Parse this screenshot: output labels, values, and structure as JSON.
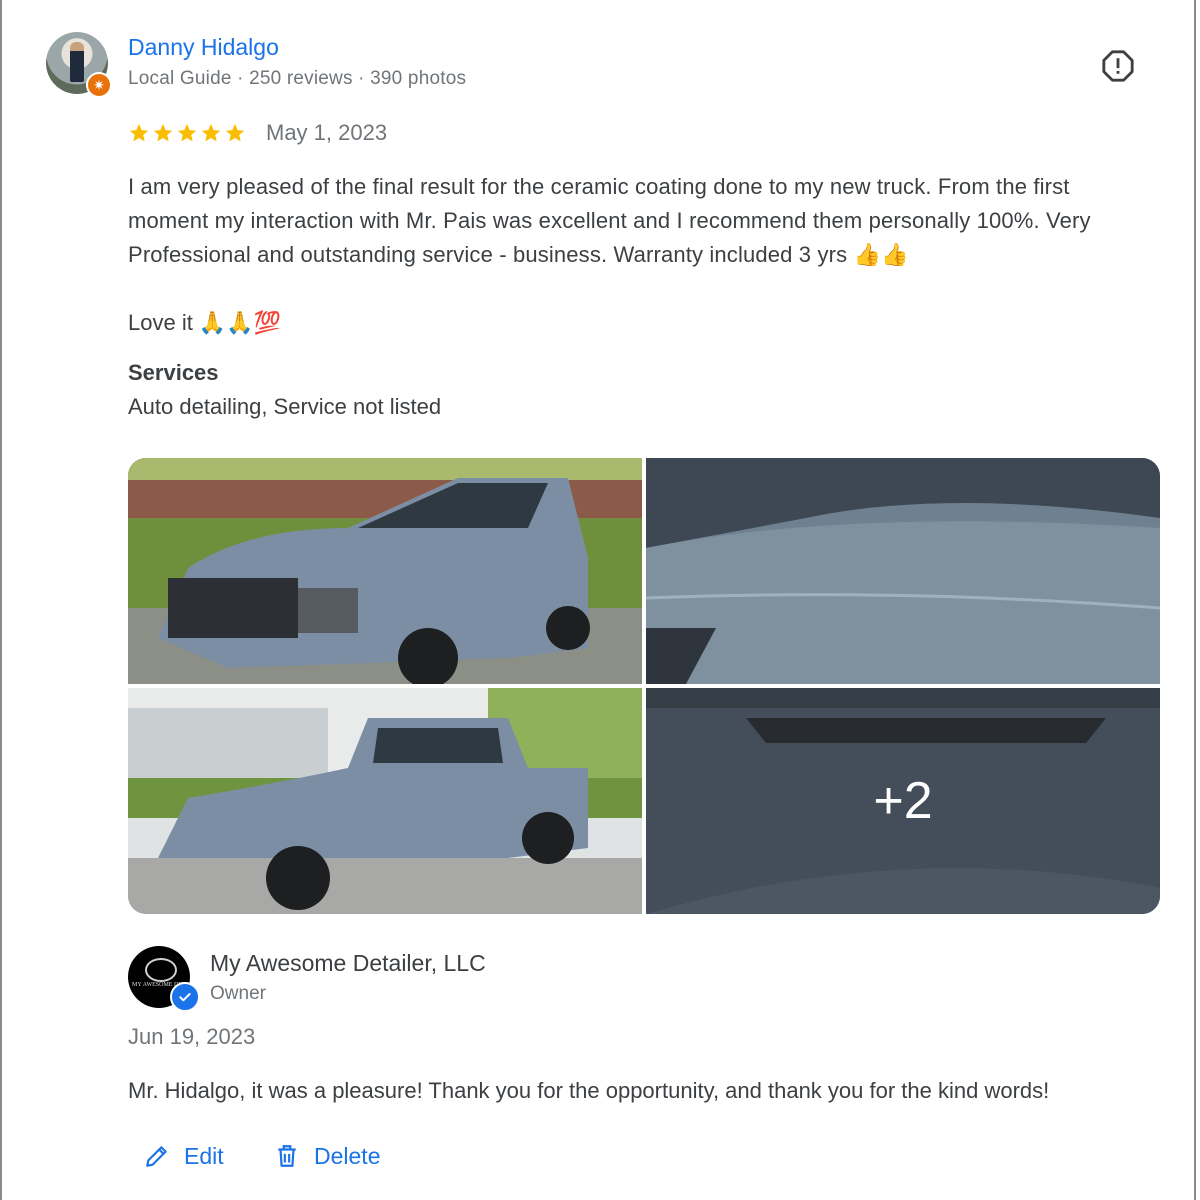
{
  "reviewer": {
    "name": "Danny Hidalgo",
    "meta": "Local Guide · 250 reviews · 390 photos",
    "badge_icon": "local-guide-star-icon"
  },
  "review": {
    "rating": 5,
    "rating_max": 5,
    "star_color": "#fbbc04",
    "date": "May 1, 2023",
    "text": "I am very pleased of the final result for the ceramic coating done to my new truck. From the first moment my interaction with Mr. Pais was excellent and I recommend them personally 100%. Very Professional and outstanding service - business. Warranty included 3 yrs 👍👍",
    "text2": "Love it 🙏🙏💯",
    "services_title": "Services",
    "services_value": "Auto detailing, Service not listed"
  },
  "photos": {
    "more_label": "+2"
  },
  "owner": {
    "name": "My Awesome Detailer, LLC",
    "role": "Owner",
    "logo_text": "MY AWESOME DETAILER",
    "reply_date": "Jun 19, 2023",
    "reply_text": "Mr. Hidalgo, it was a pleasure! Thank you for the opportunity, and thank you for the kind words!"
  },
  "actions": {
    "edit_label": "Edit",
    "delete_label": "Delete"
  },
  "colors": {
    "link": "#1a73e8",
    "text": "#3c4043",
    "muted": "#70757a"
  }
}
